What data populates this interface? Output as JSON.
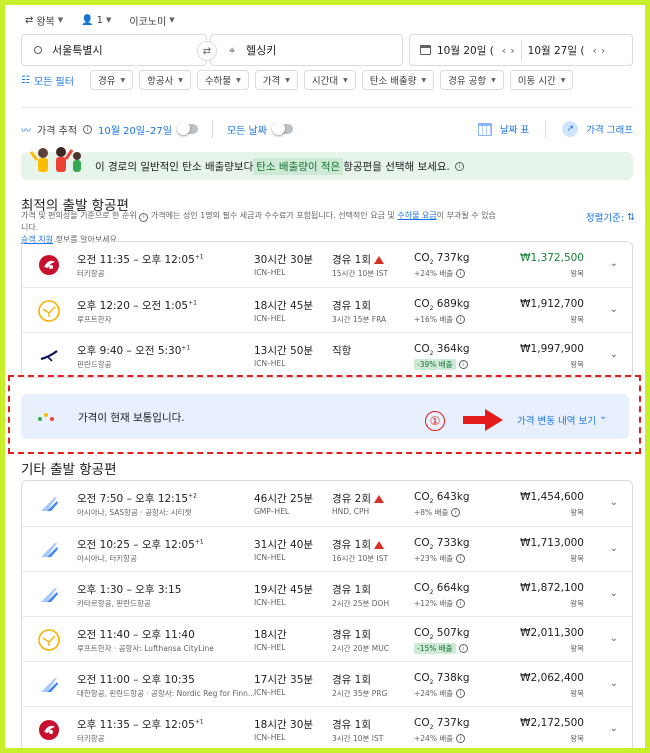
{
  "top": {
    "trip_type": "왕복",
    "passengers": "1",
    "cabin": "이코노미"
  },
  "search": {
    "origin": "서울특별시",
    "destination": "헬싱키",
    "depart_date": "10월 20일 (",
    "return_date": "10월 27일 ("
  },
  "filters": {
    "all_filters": "모든 필터",
    "chips": [
      "경유",
      "항공사",
      "수하물",
      "가격",
      "시간대",
      "탄소 배출량",
      "경유 공항",
      "이동 시간"
    ]
  },
  "tracking": {
    "label": "가격 추적",
    "dates": "10월 20일–27일",
    "any_dates": "모든 날짜",
    "date_grid": "날짜 표",
    "price_graph": "가격 그래프"
  },
  "banner": {
    "pre": "이 경로의 일반적인 탄소 배출량보다 ",
    "highlight": "탄소 배출량이 적은",
    "post": " 항공편을 선택해 보세요."
  },
  "best": {
    "title": "최적의 출발 항공편",
    "sub_line1": "가격 및 편의성을 기준으로 한 순위",
    "sub_line1b": "가격에는 성인 1명의 필수 세금과 수수료가 포함됩니다. 선택적인 요금 및",
    "sub_link": "수하물 요금",
    "sub_line1c": "이 부과될 수 있습니다.",
    "sub_link2": "승객 지원",
    "sub_line2": " 정보를 알아보세요.",
    "sort_label": "정렬기준:"
  },
  "flights_best": [
    {
      "logo": "turkish",
      "times": "오전 11:35 – 오후 12:05",
      "plus": "+1",
      "airline": "터키항공",
      "duration": "30시간 30분",
      "route": "ICN–HEL",
      "stops": "경유 1회",
      "warn": true,
      "layover": "15시간 10분 IST",
      "co2": "737kg",
      "co2diff": "+24% 배출",
      "good": false,
      "price": "₩1,372,500",
      "green": true,
      "ptype": "왕복"
    },
    {
      "logo": "lufthansa",
      "times": "오후 12:20 – 오전 1:05",
      "plus": "+1",
      "airline": "루프트한자",
      "duration": "18시간 45분",
      "route": "ICN–HEL",
      "stops": "경유 1회",
      "warn": false,
      "layover": "3시간 15분 FRA",
      "co2": "689kg",
      "co2diff": "+16% 배출",
      "good": false,
      "price": "₩1,912,700",
      "green": false,
      "ptype": "왕복"
    },
    {
      "logo": "finnair",
      "times": "오후 9:40 – 오전 5:30",
      "plus": "+1",
      "airline": "핀란드항공",
      "duration": "13시간 50분",
      "route": "ICN–HEL",
      "stops": "직항",
      "warn": false,
      "layover": "",
      "co2": "364kg",
      "co2diff": "-39% 배출",
      "good": true,
      "price": "₩1,997,900",
      "green": false,
      "ptype": "왕복"
    }
  ],
  "insight": {
    "text": "가격이 현재 보통입니다.",
    "marker": "①",
    "history": "가격 변동 내역 보기"
  },
  "other": {
    "title": "기타 출발 항공편"
  },
  "flights_other": [
    {
      "logo": "multi",
      "times": "오전 7:50 – 오후 12:15",
      "plus": "+2",
      "airline": "아시아나, SAS항공 · 공항사: 시티젯",
      "duration": "46시간 25분",
      "route": "GMP–HEL",
      "stops": "경유 2회",
      "warn": true,
      "layover": "HND, CPH",
      "co2": "643kg",
      "co2diff": "+8% 배출",
      "good": false,
      "price": "₩1,454,600",
      "green": false,
      "ptype": "왕복"
    },
    {
      "logo": "multi",
      "times": "오전 10:25 – 오후 12:05",
      "plus": "+1",
      "airline": "아시아나, 터키항공",
      "duration": "31시간 40분",
      "route": "ICN–HEL",
      "stops": "경유 1회",
      "warn": true,
      "layover": "16시간 10분 IST",
      "co2": "733kg",
      "co2diff": "+23% 배출",
      "good": false,
      "price": "₩1,713,000",
      "green": false,
      "ptype": "왕복"
    },
    {
      "logo": "multi",
      "times": "오후 1:30 – 오후 3:15",
      "plus": "",
      "airline": "카타르항공, 핀란드항공",
      "duration": "19시간 45분",
      "route": "ICN–HEL",
      "stops": "경유 1회",
      "warn": false,
      "layover": "2시간 25분 DOH",
      "co2": "664kg",
      "co2diff": "+12% 배출",
      "good": false,
      "price": "₩1,872,100",
      "green": false,
      "ptype": "왕복"
    },
    {
      "logo": "lufthansa",
      "times": "오전 11:40 – 오후 11:40",
      "plus": "",
      "airline": "루프트한자 · 공항사: Lufthansa CityLine",
      "duration": "18시간",
      "route": "ICN–HEL",
      "stops": "경유 1회",
      "warn": false,
      "layover": "2시간 20분 MUC",
      "co2": "507kg",
      "co2diff": "-15% 배출",
      "good": true,
      "price": "₩2,011,300",
      "green": false,
      "ptype": "왕복"
    },
    {
      "logo": "multi",
      "times": "오전 11:00 – 오후 10:35",
      "plus": "",
      "airline": "대한항공, 핀란드항공 · 공항사: Nordic Reg for Finn...",
      "duration": "17시간 35분",
      "route": "ICN–HEL",
      "stops": "경유 1회",
      "warn": false,
      "layover": "2시간 35분 PRG",
      "co2": "738kg",
      "co2diff": "+24% 배출",
      "good": false,
      "price": "₩2,062,400",
      "green": false,
      "ptype": "왕복"
    },
    {
      "logo": "turkish",
      "times": "오후 11:35 – 오후 12:05",
      "plus": "+1",
      "airline": "터키항공",
      "duration": "18시간 30분",
      "route": "ICN–HEL",
      "stops": "경유 1회",
      "warn": false,
      "layover": "3시간 10분 IST",
      "co2": "737kg",
      "co2diff": "+24% 배출",
      "good": false,
      "price": "₩2,172,500",
      "green": false,
      "ptype": "왕복"
    }
  ],
  "colors": {
    "accent": "#1a73e8",
    "frame": "#c8f02a",
    "annotation": "#e51c1c",
    "price_green": "#188038"
  }
}
